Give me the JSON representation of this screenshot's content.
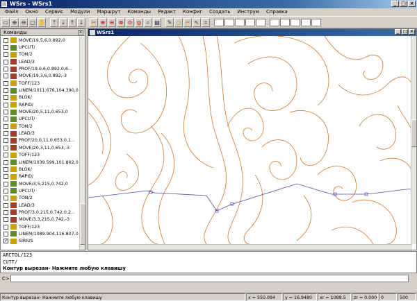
{
  "window": {
    "title": "WSrs - WSrs1"
  },
  "menu": [
    "Файл",
    "Окно",
    "Сервис",
    "Модули",
    "Маршрут",
    "Команды",
    "Редакт",
    "Конфиг",
    "Создать",
    "Инструм",
    "Справка"
  ],
  "toolbar": [
    {
      "icon": "document-icon",
      "glyph": "▭",
      "color": ""
    },
    {
      "icon": "zoom-in-icon",
      "glyph": "⊕",
      "color": ""
    },
    {
      "icon": "zoom-out-icon",
      "glyph": "⊖",
      "color": ""
    },
    {
      "icon": "zoom-window-icon",
      "glyph": "▢",
      "color": ""
    },
    {
      "icon": "hand-icon",
      "glyph": "✋",
      "color": "orange"
    },
    {
      "sep": true
    },
    {
      "icon": "arrow-up-bar-icon",
      "glyph": "⤒",
      "color": ""
    },
    {
      "icon": "arrow-down-bar-icon",
      "glyph": "⤓",
      "color": ""
    },
    {
      "icon": "arrow-up-icon",
      "glyph": "↑",
      "color": ""
    },
    {
      "icon": "arrow-down-icon",
      "glyph": "↓",
      "color": ""
    },
    {
      "sep": true
    },
    {
      "icon": "tool-icon",
      "glyph": "✂",
      "color": "orange"
    },
    {
      "icon": "zoom-in-red-icon",
      "glyph": "⊕",
      "color": "red"
    },
    {
      "icon": "zoom-out-red-icon",
      "glyph": "⊖",
      "color": "red"
    },
    {
      "icon": "zoom-prev-icon",
      "glyph": "⊗",
      "color": "red"
    },
    {
      "icon": "zoom-all-icon",
      "glyph": "⊙",
      "color": "red"
    },
    {
      "icon": "zoom-extents-icon",
      "glyph": "◎",
      "color": "red"
    },
    {
      "icon": "search-icon",
      "glyph": "⌕",
      "color": "blue"
    },
    {
      "icon": "layers-icon",
      "glyph": "▤",
      "color": "blue"
    },
    {
      "sep": true
    },
    {
      "icon": "pen-icon",
      "glyph": "✎",
      "color": ""
    },
    {
      "icon": "lasso-icon",
      "glyph": "◌",
      "color": "orange"
    },
    {
      "icon": "cut-icon",
      "glyph": "✂",
      "color": "orange"
    },
    {
      "icon": "pointer-icon",
      "glyph": "↖",
      "color": ""
    },
    {
      "icon": "coordinates-icon",
      "glyph": "⌗",
      "color": ""
    },
    {
      "sep": true
    },
    {
      "field": true
    },
    {
      "field": true
    },
    {
      "field": true
    },
    {
      "field": true
    },
    {
      "field": true
    },
    {
      "sep": true
    },
    {
      "field": true
    },
    {
      "field": true
    },
    {
      "field": true
    },
    {
      "field": true
    },
    {
      "field": true
    }
  ],
  "commands_panel": {
    "title": "Команды",
    "items": [
      {
        "label": "MOVE/19,5,6,0.892,0",
        "icon": "y",
        "checked": false
      },
      {
        "label": "UPCUT/",
        "icon": "g",
        "checked": false
      },
      {
        "label": "TON/2",
        "icon": "y",
        "checked": false
      },
      {
        "label": "LEAD/3",
        "icon": "r",
        "checked": false
      },
      {
        "label": "PROF/19,0,6,0.892,0,6...",
        "icon": "r",
        "checked": false
      },
      {
        "label": "MOVE/19,3,6,0.892,-3",
        "icon": "r",
        "checked": false
      },
      {
        "label": "TOFF/123",
        "icon": "y",
        "checked": false
      },
      {
        "label": "LINEM/1011.676,104.390,0",
        "icon": "g",
        "checked": false
      },
      {
        "label": "BLOK/",
        "icon": "y",
        "checked": false
      },
      {
        "label": "RAPID/",
        "icon": "y",
        "checked": false
      },
      {
        "label": "MOVE/20,5,11,0.653,0",
        "icon": "g",
        "checked": false
      },
      {
        "label": "UPCUT/",
        "icon": "g",
        "checked": false
      },
      {
        "label": "TON/2",
        "icon": "y",
        "checked": false
      },
      {
        "label": "LEAD/3",
        "icon": "r",
        "checked": false
      },
      {
        "label": "PROF/20,0,11,0.653,0,1...",
        "icon": "r",
        "checked": false
      },
      {
        "label": "MOVE/20,3,11,0.653,-3",
        "icon": "r",
        "checked": false
      },
      {
        "label": "TOFF/123",
        "icon": "y",
        "checked": false
      },
      {
        "label": "LINEM/1039.599,101.802,0",
        "icon": "g",
        "checked": false
      },
      {
        "label": "BLOK/",
        "icon": "y",
        "checked": false
      },
      {
        "label": "RAPID/",
        "icon": "y",
        "checked": false
      },
      {
        "label": "MOVE/3,5,215,0.742,0",
        "icon": "g",
        "checked": false
      },
      {
        "label": "UPCUT/",
        "icon": "g",
        "checked": false
      },
      {
        "label": "TON/2",
        "icon": "y",
        "checked": false
      },
      {
        "label": "LEAD/3",
        "icon": "r",
        "checked": false
      },
      {
        "label": "PROF/3,0,215,0.742,0,2...",
        "icon": "r",
        "checked": false
      },
      {
        "label": "MOVE/3,3,215,0.742,-3",
        "icon": "r",
        "checked": false
      },
      {
        "label": "TOFF/123",
        "icon": "y",
        "checked": false
      },
      {
        "label": "LINEM/1089.904,116.807,0",
        "icon": "g",
        "checked": false
      },
      {
        "label": "SIRIUS",
        "icon": "y",
        "checked": true
      }
    ]
  },
  "drawing_window": {
    "title": "WSrs1"
  },
  "log": [
    "ARCTOL/123",
    "CUTT/",
    "Контур вырезан- Нажмите любую клавишу"
  ],
  "command_line": {
    "prompt": "C>"
  },
  "status": {
    "message": "Контур вырезан- Нажмите любую клавишу",
    "x": "x = 550.094",
    "y": "y = 16.9480",
    "xr": "xr = 1089.5",
    "zr": "zr = 0.0000",
    "v1": "0",
    "v2": "500"
  }
}
